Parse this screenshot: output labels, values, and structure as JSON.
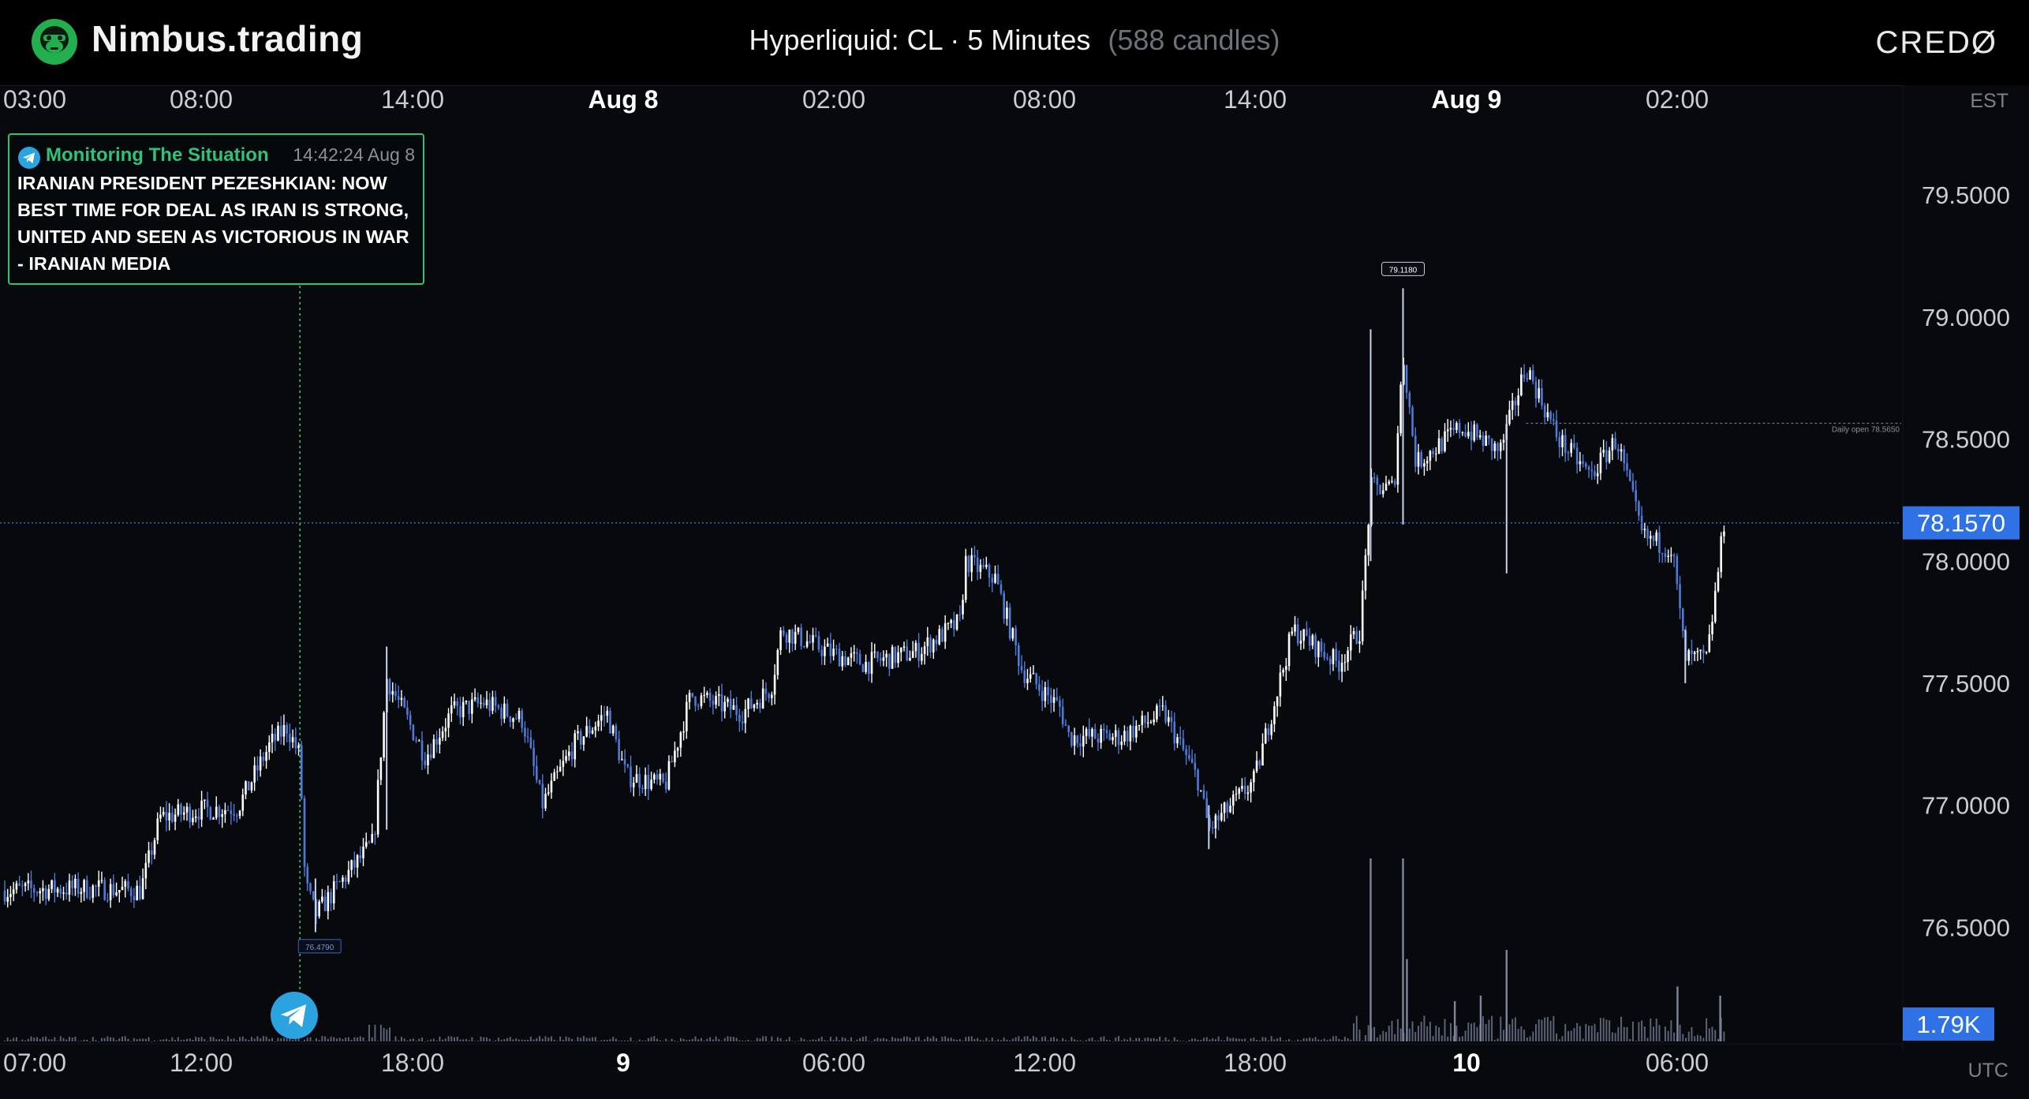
{
  "header": {
    "brand": "Nimbus.trading",
    "chart_title": "Hyperliquid: CL · 5 Minutes",
    "candle_count": "(588 candles)",
    "partner_logo": "CREDØ"
  },
  "timezones": {
    "top": "EST",
    "bottom": "UTC"
  },
  "news": {
    "source": "Monitoring The Situation",
    "time": "14:42:24 Aug 8",
    "text": "IRANIAN PRESIDENT PEZESHKIAN: NOW BEST TIME FOR DEAL AS IRAN IS STRONG, UNITED AND SEEN AS VICTORIOUS IN WAR - IRANIAN MEDIA",
    "marker_price": "76.4790",
    "icon": "telegram-icon"
  },
  "annotations": {
    "high_label": "79.1180",
    "daily_open_label": "Daily open 78.5650",
    "current_price": "78.1570",
    "volume_label": "1.79K"
  },
  "colors": {
    "background": "#07090d",
    "candle_up": "#ffffff",
    "candle_down": "#4e7ad8",
    "price_tag": "#2f72e6",
    "news_accent": "#2fc27a",
    "telegram": "#2aa3df"
  },
  "chart_data": {
    "type": "candlestick",
    "title": "Hyperliquid: CL · 5 Minutes",
    "candles": 588,
    "x_top_ticks": [
      {
        "label": "03:00",
        "bold": false
      },
      {
        "label": "08:00",
        "bold": false
      },
      {
        "label": "14:00",
        "bold": false
      },
      {
        "label": "Aug 8",
        "bold": true
      },
      {
        "label": "02:00",
        "bold": false
      },
      {
        "label": "08:00",
        "bold": false
      },
      {
        "label": "14:00",
        "bold": false
      },
      {
        "label": "Aug 9",
        "bold": true
      },
      {
        "label": "02:00",
        "bold": false
      }
    ],
    "x_bottom_ticks": [
      {
        "label": "07:00",
        "bold": false
      },
      {
        "label": "12:00",
        "bold": false
      },
      {
        "label": "18:00",
        "bold": false
      },
      {
        "label": "9",
        "bold": true
      },
      {
        "label": "06:00",
        "bold": false
      },
      {
        "label": "12:00",
        "bold": false
      },
      {
        "label": "18:00",
        "bold": false
      },
      {
        "label": "10",
        "bold": true
      },
      {
        "label": "06:00",
        "bold": false
      }
    ],
    "y_ticks": [
      "79.5000",
      "79.0000",
      "78.5000",
      "78.0000",
      "77.5000",
      "77.0000",
      "76.5000"
    ],
    "ylim": [
      76.0,
      79.95
    ],
    "price_path": [
      [
        0,
        76.65
      ],
      [
        60,
        76.66
      ],
      [
        105,
        76.65
      ],
      [
        120,
        76.95
      ],
      [
        150,
        76.98
      ],
      [
        180,
        76.99
      ],
      [
        205,
        77.25
      ],
      [
        218,
        77.32
      ],
      [
        228,
        77.2
      ],
      [
        232,
        76.68
      ],
      [
        240,
        76.55
      ],
      [
        262,
        76.7
      ],
      [
        285,
        76.85
      ],
      [
        295,
        77.52
      ],
      [
        325,
        77.2
      ],
      [
        345,
        77.38
      ],
      [
        370,
        77.42
      ],
      [
        400,
        77.35
      ],
      [
        415,
        77.0
      ],
      [
        440,
        77.25
      ],
      [
        465,
        77.38
      ],
      [
        480,
        77.12
      ],
      [
        510,
        77.08
      ],
      [
        530,
        77.45
      ],
      [
        570,
        77.38
      ],
      [
        592,
        77.48
      ],
      [
        600,
        77.72
      ],
      [
        640,
        77.62
      ],
      [
        665,
        77.58
      ],
      [
        705,
        77.63
      ],
      [
        738,
        77.75
      ],
      [
        742,
        78.0
      ],
      [
        765,
        77.93
      ],
      [
        786,
        77.55
      ],
      [
        815,
        77.4
      ],
      [
        822,
        77.28
      ],
      [
        862,
        77.28
      ],
      [
        895,
        77.38
      ],
      [
        922,
        77.1
      ],
      [
        930,
        76.9
      ],
      [
        965,
        77.1
      ],
      [
        995,
        77.72
      ],
      [
        1030,
        77.58
      ],
      [
        1047,
        77.72
      ],
      [
        1055,
        78.3
      ],
      [
        1073,
        78.3
      ],
      [
        1080,
        78.85
      ],
      [
        1090,
        78.4
      ],
      [
        1125,
        78.55
      ],
      [
        1155,
        78.45
      ],
      [
        1175,
        78.8
      ],
      [
        1200,
        78.5
      ],
      [
        1225,
        78.35
      ],
      [
        1245,
        78.5
      ],
      [
        1265,
        78.1
      ],
      [
        1288,
        78.05
      ],
      [
        1298,
        77.6
      ],
      [
        1315,
        77.6
      ],
      [
        1328,
        78.16
      ]
    ],
    "spikes": [
      {
        "x": 1080,
        "low": 78.15,
        "high": 79.118
      },
      {
        "x": 1160,
        "low": 77.95,
        "high": 78.6
      },
      {
        "x": 1055,
        "low": 78.0,
        "high": 78.95
      },
      {
        "x": 1298,
        "low": 77.5,
        "high": 77.72
      },
      {
        "x": 930,
        "low": 76.82,
        "high": 77.0
      },
      {
        "x": 240,
        "low": 76.48,
        "high": 76.7
      },
      {
        "x": 295,
        "low": 76.9,
        "high": 77.65
      }
    ],
    "daily_open": 78.565,
    "current_price": 78.157,
    "event_x": 228,
    "event_price": 76.479,
    "session_high": 79.118,
    "volume_spikes": [
      {
        "x": 1055,
        "v": 1.0
      },
      {
        "x": 1080,
        "v": 1.0
      },
      {
        "x": 1160,
        "v": 0.5
      },
      {
        "x": 1083,
        "v": 0.45
      },
      {
        "x": 1325,
        "v": 0.25
      },
      {
        "x": 1292,
        "v": 0.3
      },
      {
        "x": 1120,
        "v": 0.22
      },
      {
        "x": 1140,
        "v": 0.25
      }
    ],
    "volume_current": "1.79K",
    "xlabel": "",
    "ylabel": "",
    "grid": false
  }
}
